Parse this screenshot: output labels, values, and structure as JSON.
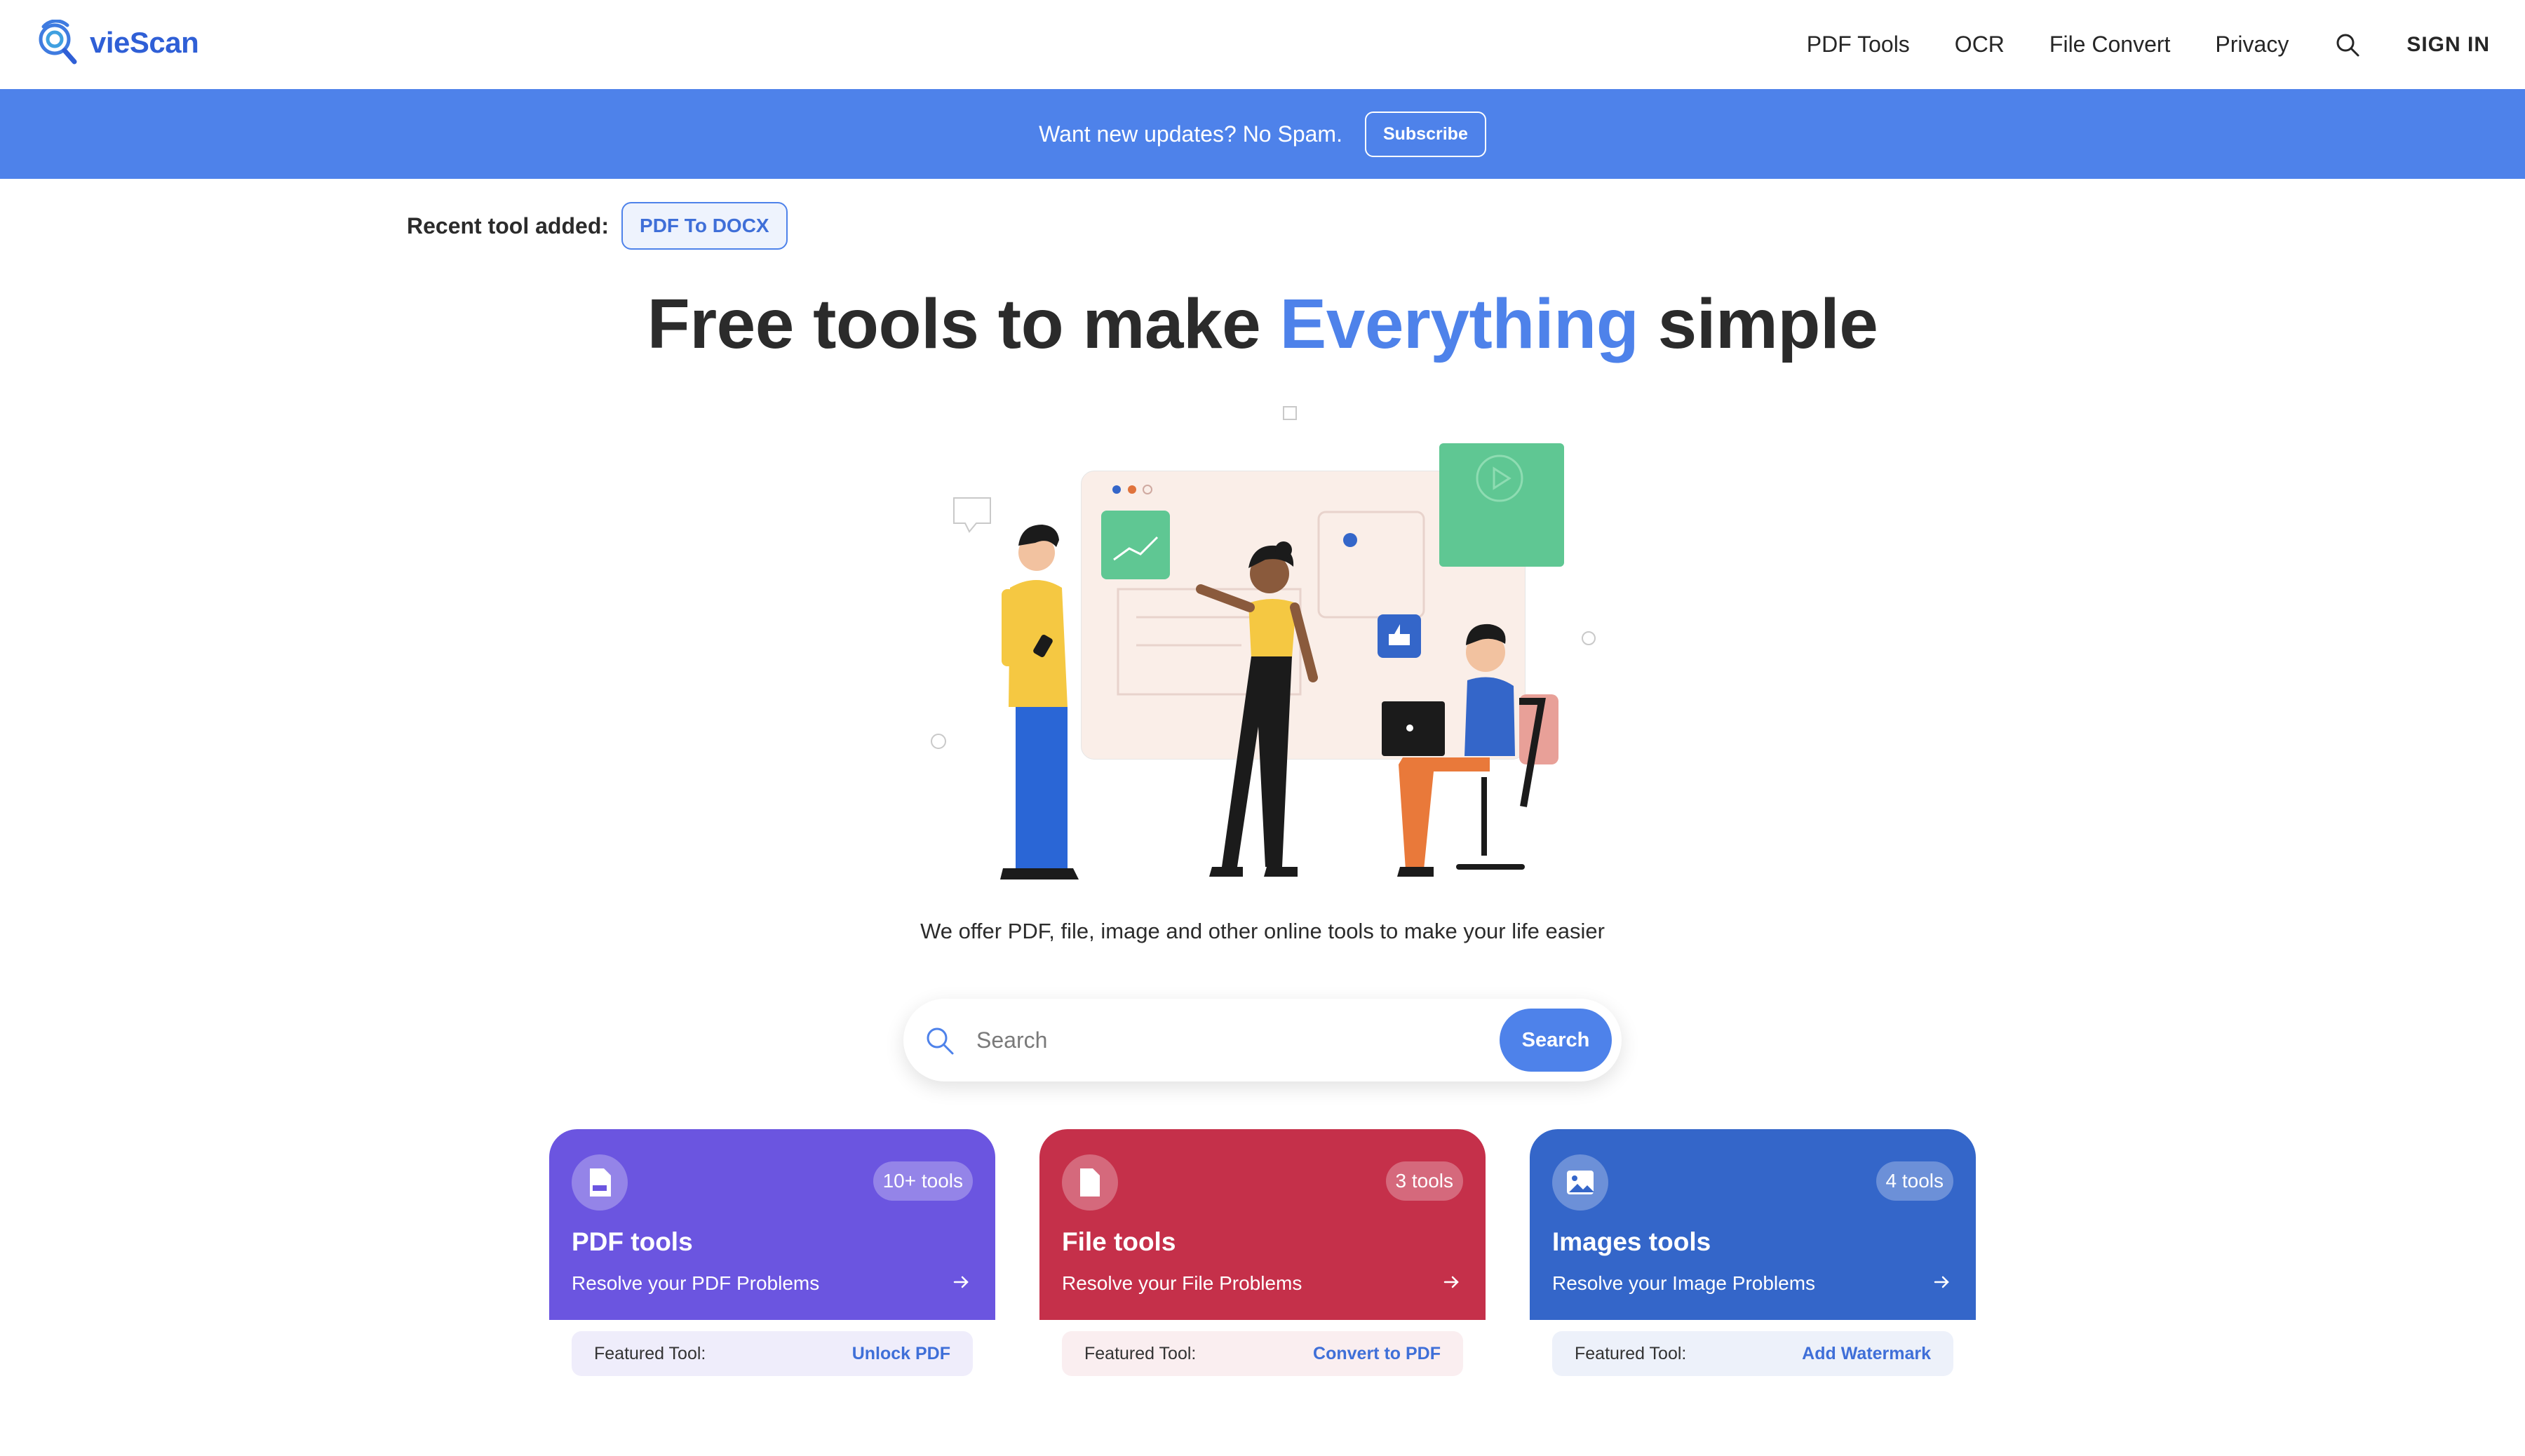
{
  "brand": {
    "name": "vieScan",
    "color": "#2f5fd6"
  },
  "nav": {
    "links": [
      "PDF Tools",
      "OCR",
      "File Convert",
      "Privacy"
    ],
    "search_icon": "search-icon",
    "signin": "SIGN IN"
  },
  "banner": {
    "text": "Want new updates? No Spam.",
    "button": "Subscribe",
    "color": "#4e82ea"
  },
  "recent": {
    "label": "Recent tool added:",
    "tool": "PDF To DOCX"
  },
  "hero": {
    "title_before": "Free tools to make ",
    "title_accent": "Everything",
    "title_after": " simple",
    "accent_color": "#4e82ea",
    "tagline": "We offer PDF, file, image and other online tools to make your life easier"
  },
  "search": {
    "placeholder": "Search",
    "button": "Search"
  },
  "cards": [
    {
      "title": "PDF tools",
      "count": "10+ tools",
      "subtitle": "Resolve your PDF Problems",
      "icon": "pdf-file-icon",
      "color": "#6b55e0",
      "featured_label": "Featured Tool:",
      "featured_tool": "Unlock PDF",
      "featured_bg": "#efedfb"
    },
    {
      "title": "File tools",
      "count": "3 tools",
      "subtitle": "Resolve your File Problems",
      "icon": "file-icon",
      "color": "#c5304a",
      "featured_label": "Featured Tool:",
      "featured_tool": "Convert to PDF",
      "featured_bg": "#faeef0"
    },
    {
      "title": "Images tools",
      "count": "4 tools",
      "subtitle": "Resolve your Image Problems",
      "icon": "image-icon",
      "color": "#3466c9",
      "featured_label": "Featured Tool:",
      "featured_tool": "Add Watermark",
      "featured_bg": "#edf1fa"
    }
  ]
}
